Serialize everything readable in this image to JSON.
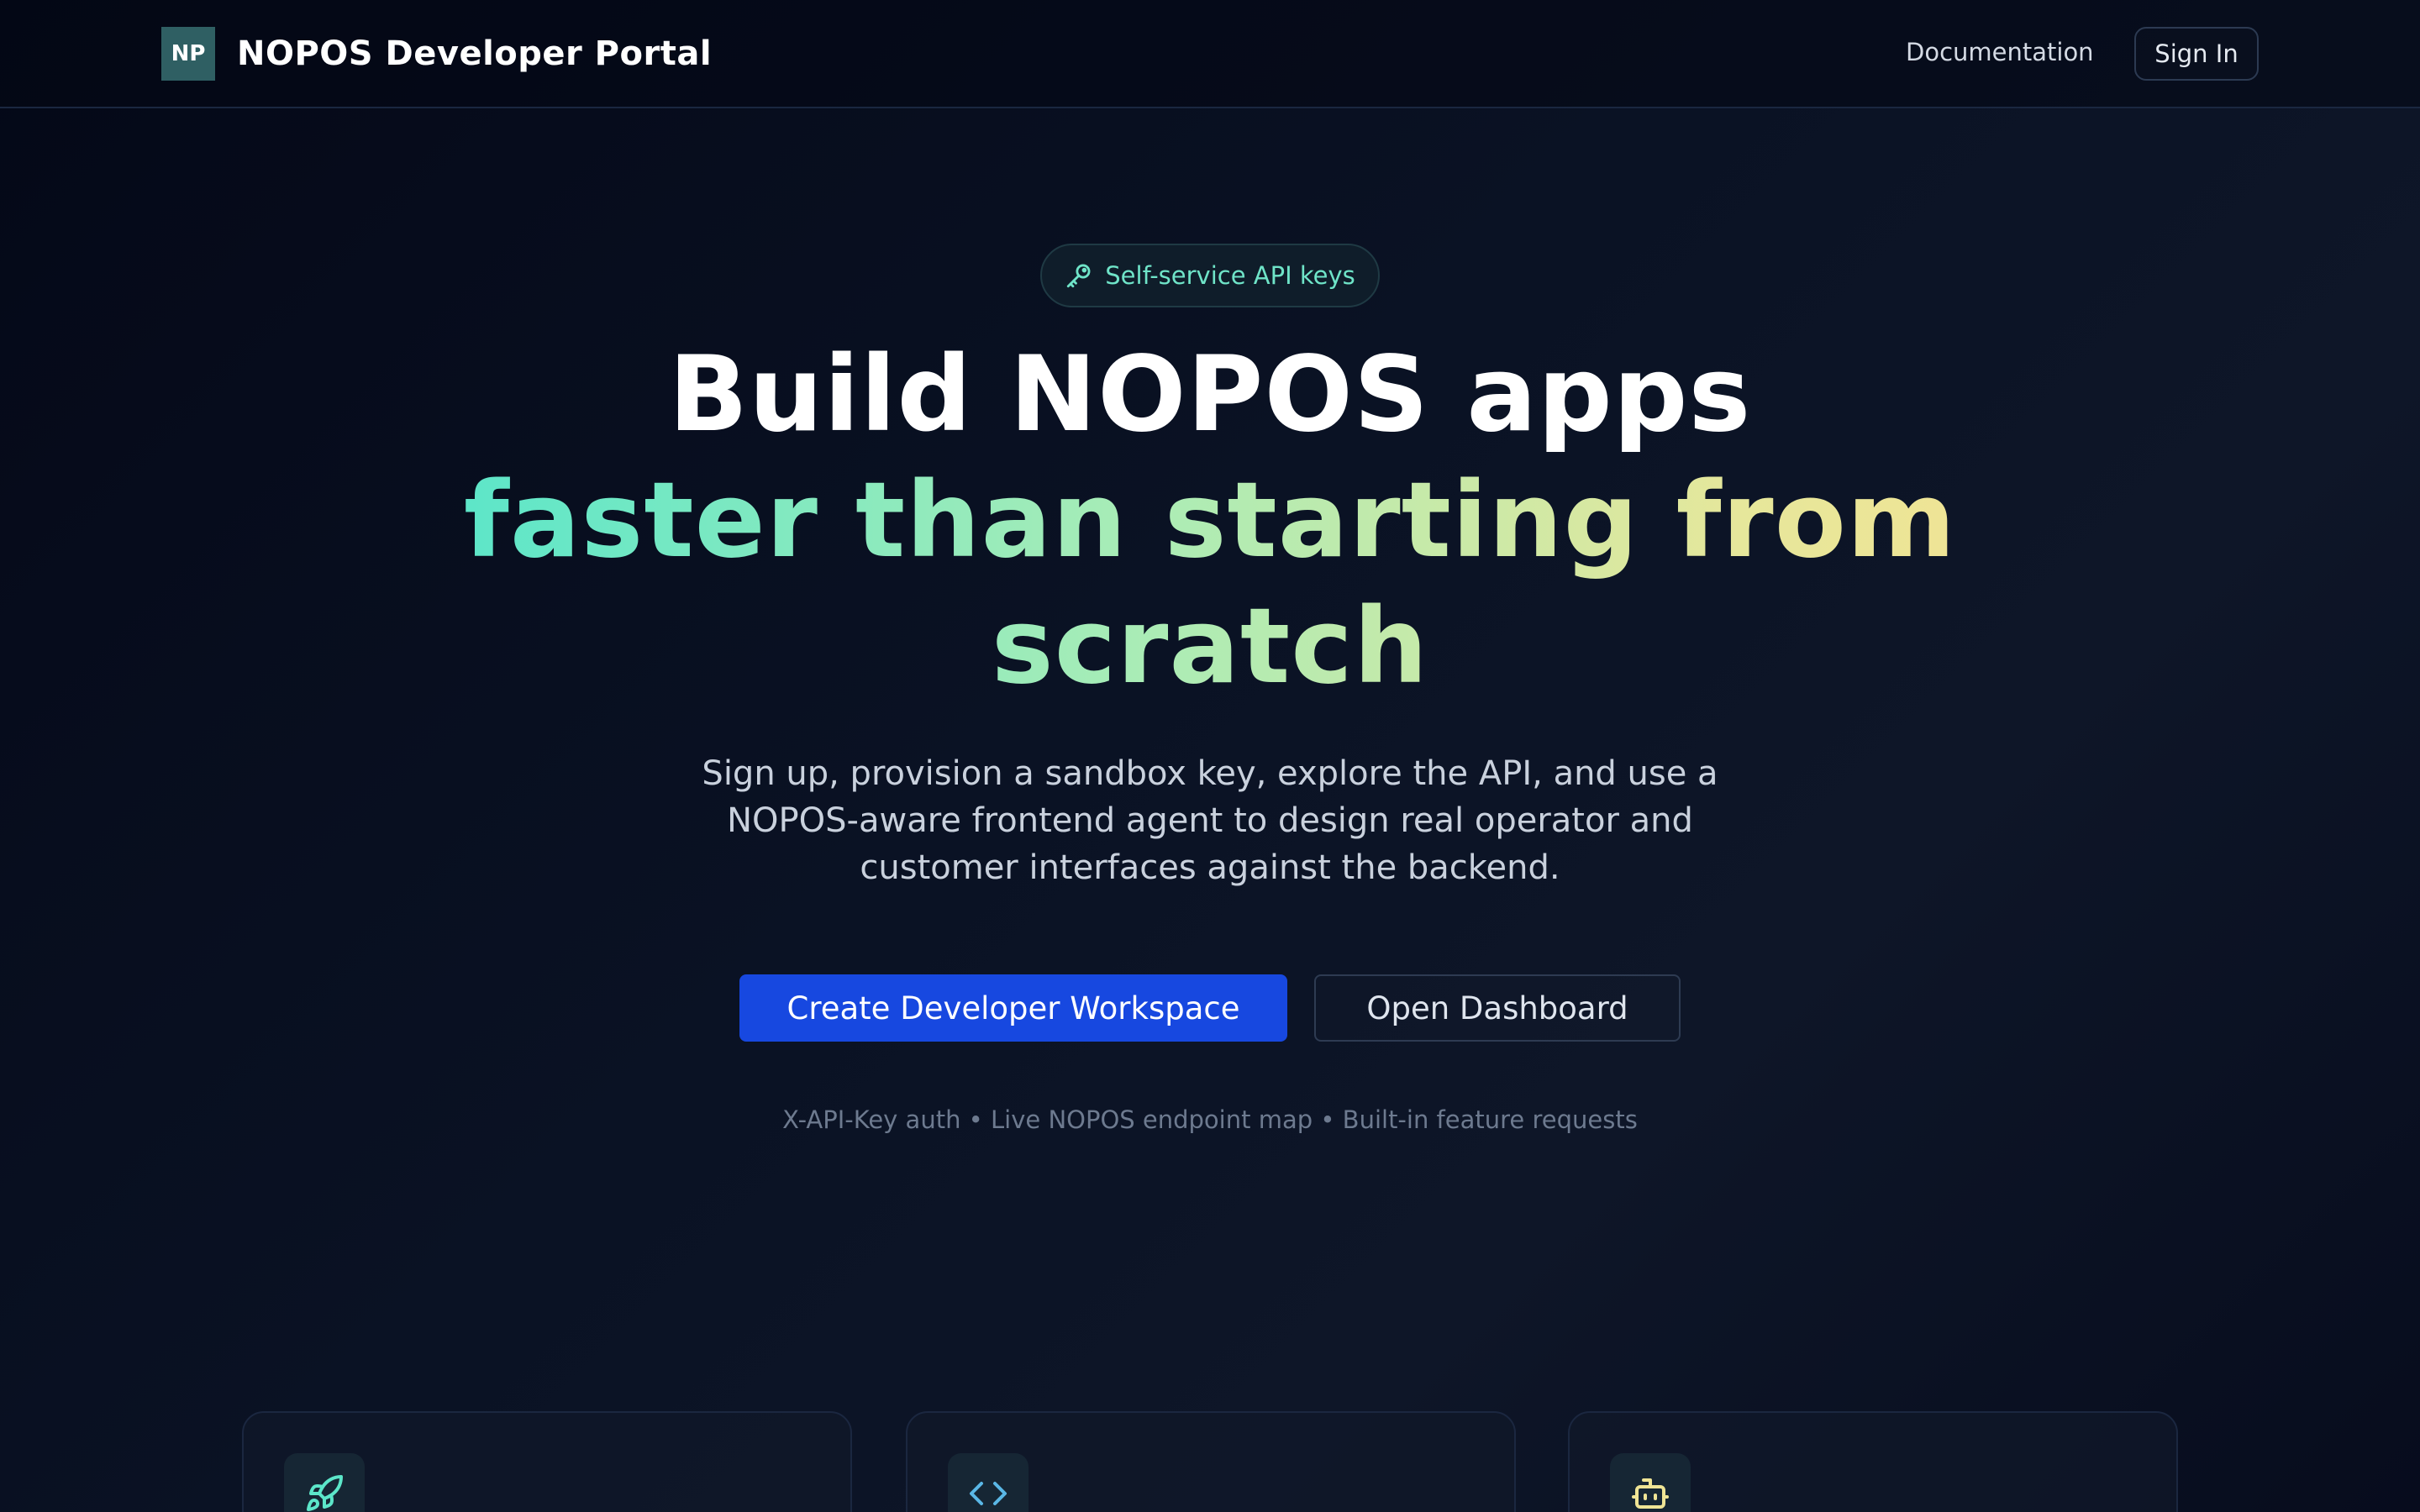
{
  "header": {
    "logo_text": "NP",
    "brand_name": "NOPOS Developer Portal",
    "nav_documentation": "Documentation",
    "nav_sign_in": "Sign In"
  },
  "hero": {
    "badge_icon": "key-icon",
    "badge_label": "Self-service API keys",
    "headline_line1": "Build NOPOS apps",
    "headline_gradient": "faster than starting from scratch",
    "subtitle": "Sign up, provision a sandbox key, explore the API, and use a NOPOS-aware frontend agent to design real operator and customer interfaces against the backend.",
    "primary_button": "Create Developer Workspace",
    "secondary_button": "Open Dashboard",
    "features_line": "X-API-Key auth • Live NOPOS endpoint map • Built-in feature requests"
  },
  "cards": [
    {
      "icon": "rocket-icon"
    },
    {
      "icon": "code-icon"
    },
    {
      "icon": "bot-icon"
    }
  ],
  "colors": {
    "accent_blue": "#1748e0",
    "accent_teal": "#5ce6c9",
    "accent_yellow": "#efe495",
    "background": "#0a1224"
  }
}
